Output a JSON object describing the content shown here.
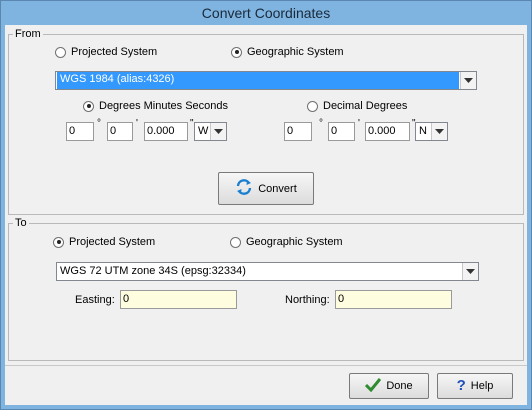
{
  "window": {
    "title": "Convert Coordinates"
  },
  "from": {
    "group_label": "From",
    "radio_projected": "Projected System",
    "radio_geographic": "Geographic System",
    "selected_system": "geographic",
    "coord_system": "WGS 1984 (alias:4326)",
    "format_dms": "Degrees Minutes Seconds",
    "format_decimal": "Decimal Degrees",
    "selected_format": "dms",
    "lon": {
      "deg": "0",
      "min": "0",
      "sec": "0.000",
      "hemi": "W"
    },
    "lat": {
      "deg": "0",
      "min": "0",
      "sec": "0.000",
      "hemi": "N"
    },
    "symbols": {
      "deg": "°",
      "min": "'",
      "sec": "\""
    },
    "convert_label": "Convert"
  },
  "to": {
    "group_label": "To",
    "radio_projected": "Projected System",
    "radio_geographic": "Geographic System",
    "selected_system": "projected",
    "coord_system": "WGS 72 UTM zone 34S (epsg:32334)",
    "easting_label": "Easting:",
    "easting_value": "0",
    "northing_label": "Northing:",
    "northing_value": "0"
  },
  "footer": {
    "done_label": "Done",
    "help_label": "Help"
  },
  "icons": {
    "convert": "refresh-icon",
    "done": "checkmark-icon",
    "help": "question-icon"
  },
  "colors": {
    "selection": "#3399ff",
    "title_bar": "#7fb3e0",
    "input_highlight": "#fffde0"
  }
}
